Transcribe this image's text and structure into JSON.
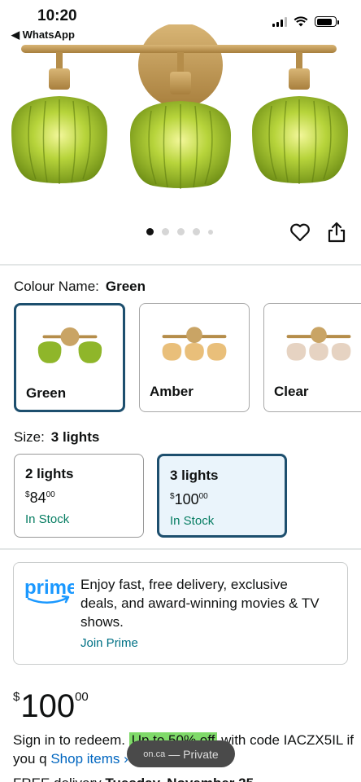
{
  "status_bar": {
    "time": "10:20",
    "back_label": "◀ WhatsApp"
  },
  "carousel": {
    "total_dots": 5,
    "active_index": 0
  },
  "colour": {
    "label": "Colour Name:",
    "selected": "Green",
    "options": [
      {
        "name": "Green",
        "shade_color": "#8fb62a"
      },
      {
        "name": "Amber",
        "shade_color": "#e9bf7a"
      },
      {
        "name": "Clear",
        "shade_color": "#e6d3c2"
      }
    ]
  },
  "size": {
    "label": "Size:",
    "selected": "3 lights",
    "options": [
      {
        "title": "2 lights",
        "currency": "$",
        "price_whole": "84",
        "price_fraction": "00",
        "stock": "In Stock"
      },
      {
        "title": "3 lights",
        "currency": "$",
        "price_whole": "100",
        "price_fraction": "00",
        "stock": "In Stock"
      }
    ]
  },
  "prime": {
    "logo_text": "prime",
    "text": "Enjoy fast, free delivery, exclusive deals, and award-winning movies & TV shows.",
    "join_label": "Join Prime"
  },
  "price": {
    "currency": "$",
    "whole": "100",
    "fraction": "00"
  },
  "promo": {
    "prefix": "Sign in to redeem.",
    "highlight": "Up to 50% off",
    "code_text": "with code IACZX5IL if you q",
    "shop_link": "Shop items ›"
  },
  "delivery": {
    "prefix": "FREE delivery",
    "date": "Tuesday, November 25"
  },
  "browser_pill": {
    "domain": "on.ca",
    "mode": "— Private"
  },
  "colors": {
    "brand_green": "#8fb62a",
    "selected_border": "#1d4f6e",
    "stock_green": "#067d62",
    "link_blue": "#007185"
  }
}
